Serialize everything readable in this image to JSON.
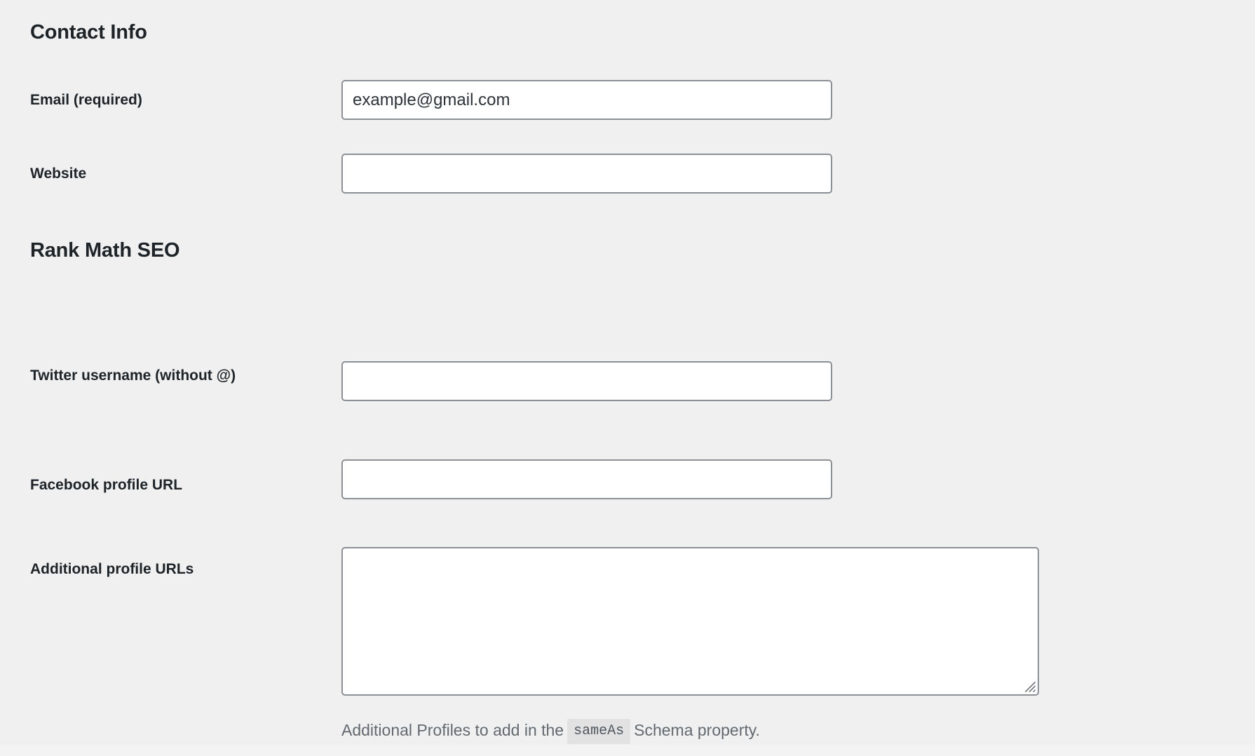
{
  "page": {
    "background_color": "#f0f0f1",
    "text_color": "#1d2327",
    "muted_text_color": "#646970",
    "input_border_color": "#8c8f94",
    "input_background": "#ffffff",
    "code_chip_background": "#e2e2e3"
  },
  "sections": [
    {
      "id": "contact-info",
      "heading": "Contact Info",
      "fields": [
        {
          "id": "email",
          "label": "Email (required)",
          "type": "text",
          "value": "example@gmail.com",
          "placeholder": ""
        },
        {
          "id": "website",
          "label": "Website",
          "type": "text",
          "value": "",
          "placeholder": ""
        }
      ]
    },
    {
      "id": "rank-math-seo",
      "heading": "Rank Math SEO",
      "fields": [
        {
          "id": "twitter-username",
          "label": "Twitter username (without @)",
          "type": "text",
          "value": "",
          "placeholder": ""
        },
        {
          "id": "facebook-profile-url",
          "label": "Facebook profile URL",
          "type": "text",
          "value": "",
          "placeholder": ""
        },
        {
          "id": "additional-profile-urls",
          "label": "Additional profile URLs",
          "type": "textarea",
          "value": "",
          "placeholder": "",
          "help": {
            "before": "Additional Profiles to add in the",
            "code": "sameAs",
            "after": "Schema property."
          }
        }
      ]
    }
  ]
}
